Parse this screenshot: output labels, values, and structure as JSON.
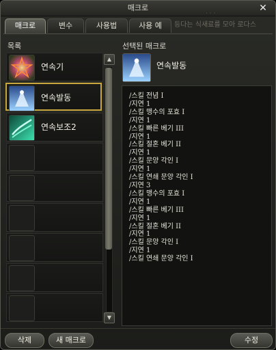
{
  "window": {
    "title": "매크로"
  },
  "tabs": [
    {
      "label": "매크로"
    },
    {
      "label": "변수"
    },
    {
      "label": "사용법"
    },
    {
      "label": "사용 예"
    }
  ],
  "background_text": "등다는 식새료를 모아 로다스",
  "list": {
    "heading": "목록",
    "items": [
      {
        "name": "연속기",
        "icon": "spark-star-icon",
        "color": "#d85a2a"
      },
      {
        "name": "연속발동",
        "icon": "frost-figure-icon",
        "color": "#6aa6e8"
      },
      {
        "name": "연속보조2",
        "icon": "green-wave-icon",
        "color": "#2fbf9a"
      }
    ]
  },
  "selected": {
    "heading": "선택된 매크로",
    "name": "연속발동",
    "accent": "#c8a83e",
    "lines": [
      "/스킬 전념 I",
      "/지연 1",
      "/스킬 맹수의 포효 I",
      "/지연 1",
      "/스킬 빠른 베기 III",
      "/지연 1",
      "/스킬 절혼 베기 II",
      "/지연 1",
      "/스킬 문양 각인 I",
      "/지연 1",
      "/스킬 연쇄 문양 각인 I",
      "/지연 3",
      "/스킬 맹수의 포효 I",
      "/지연 1",
      "/스킬 빠른 베기 III",
      "/지연 1",
      "/스킬 절혼 베기 II",
      "/지연 1",
      "/스킬 문양 각인 I",
      "/지연 1",
      "/스킬 연쇄 문양 각인 I"
    ]
  },
  "buttons": {
    "delete": "삭제",
    "new_macro": "새 매크로",
    "edit": "수정"
  }
}
